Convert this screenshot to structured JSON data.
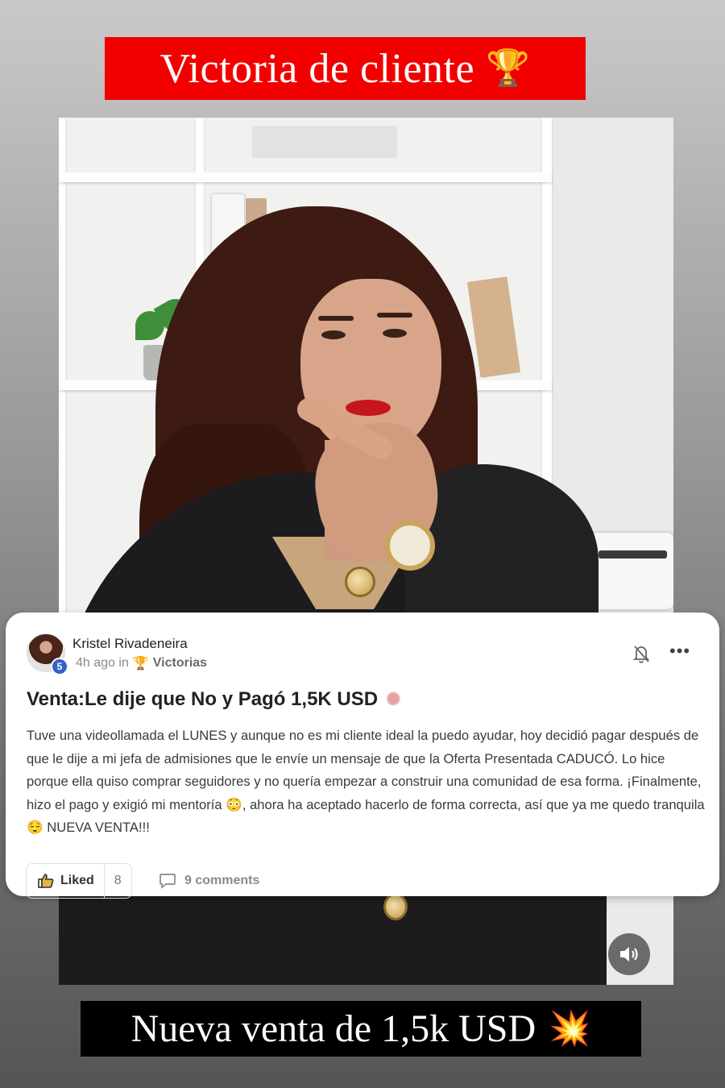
{
  "header": {
    "title": "Victoria de cliente",
    "trophy_icon": "trophy-icon",
    "background_color": "#f20000"
  },
  "post": {
    "author": "Kristel Rivadeneira",
    "level": "5",
    "time": "4h ago in",
    "category": "Victorias",
    "title": "Venta:Le dije que No y Pagó 1,5K USD",
    "body": "Tuve una videollamada el LUNES y aunque no es mi cliente ideal la puedo ayudar, hoy decidió pagar después de que le dije a mi jefa de admisiones que le envíe un mensaje de que la Oferta Presentada CADUCÓ. Lo hice porque ella quiso comprar seguidores y no quería empezar a construir una comunidad de esa forma. ¡Finalmente, hizo el pago y exigió mi mentoría 😳, ahora ha aceptado hacerlo de forma correcta, así que ya me quedo tranquila 😌 NUEVA VENTA!!!",
    "like_label": "Liked",
    "like_count": "8",
    "comments_label": "9 comments"
  },
  "footer": {
    "text": "Nueva venta de 1,5k USD",
    "burst_icon": "explosion-icon"
  }
}
